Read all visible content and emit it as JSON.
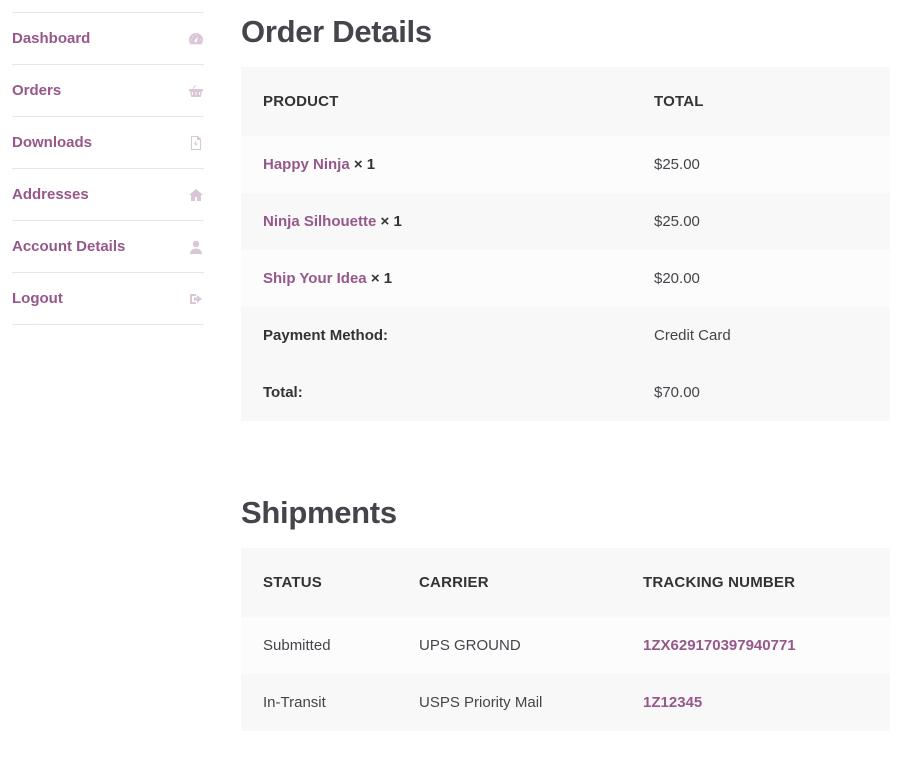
{
  "nav": [
    {
      "label": "Dashboard",
      "icon": "dashboard-icon"
    },
    {
      "label": "Orders",
      "icon": "basket-icon"
    },
    {
      "label": "Downloads",
      "icon": "file-icon"
    },
    {
      "label": "Addresses",
      "icon": "home-icon"
    },
    {
      "label": "Account Details",
      "icon": "user-icon"
    },
    {
      "label": "Logout",
      "icon": "sign-out-icon"
    }
  ],
  "order": {
    "title": "Order Details",
    "col_product": "PRODUCT",
    "col_total": "TOTAL",
    "items": [
      {
        "name": "Happy Ninja",
        "qty": "× 1",
        "total": "$25.00"
      },
      {
        "name": "Ninja Silhouette",
        "qty": "× 1",
        "total": "$25.00"
      },
      {
        "name": "Ship Your Idea",
        "qty": "× 1",
        "total": "$20.00"
      }
    ],
    "payment_label": "Payment Method:",
    "payment_value": "Credit Card",
    "total_label": "Total:",
    "total_value": "$70.00"
  },
  "shipments": {
    "title": "Shipments",
    "col_status": "STATUS",
    "col_carrier": "CARRIER",
    "col_tracking": "TRACKING NUMBER",
    "rows": [
      {
        "status": "Submitted",
        "carrier": "UPS GROUND",
        "tracking": "1ZX629170397940771"
      },
      {
        "status": "In-Transit",
        "carrier": "USPS Priority Mail",
        "tracking": "1Z12345"
      }
    ]
  },
  "colors": {
    "accent": "#96588a",
    "text": "#43454b",
    "row_alt": "#f8f8f8"
  }
}
